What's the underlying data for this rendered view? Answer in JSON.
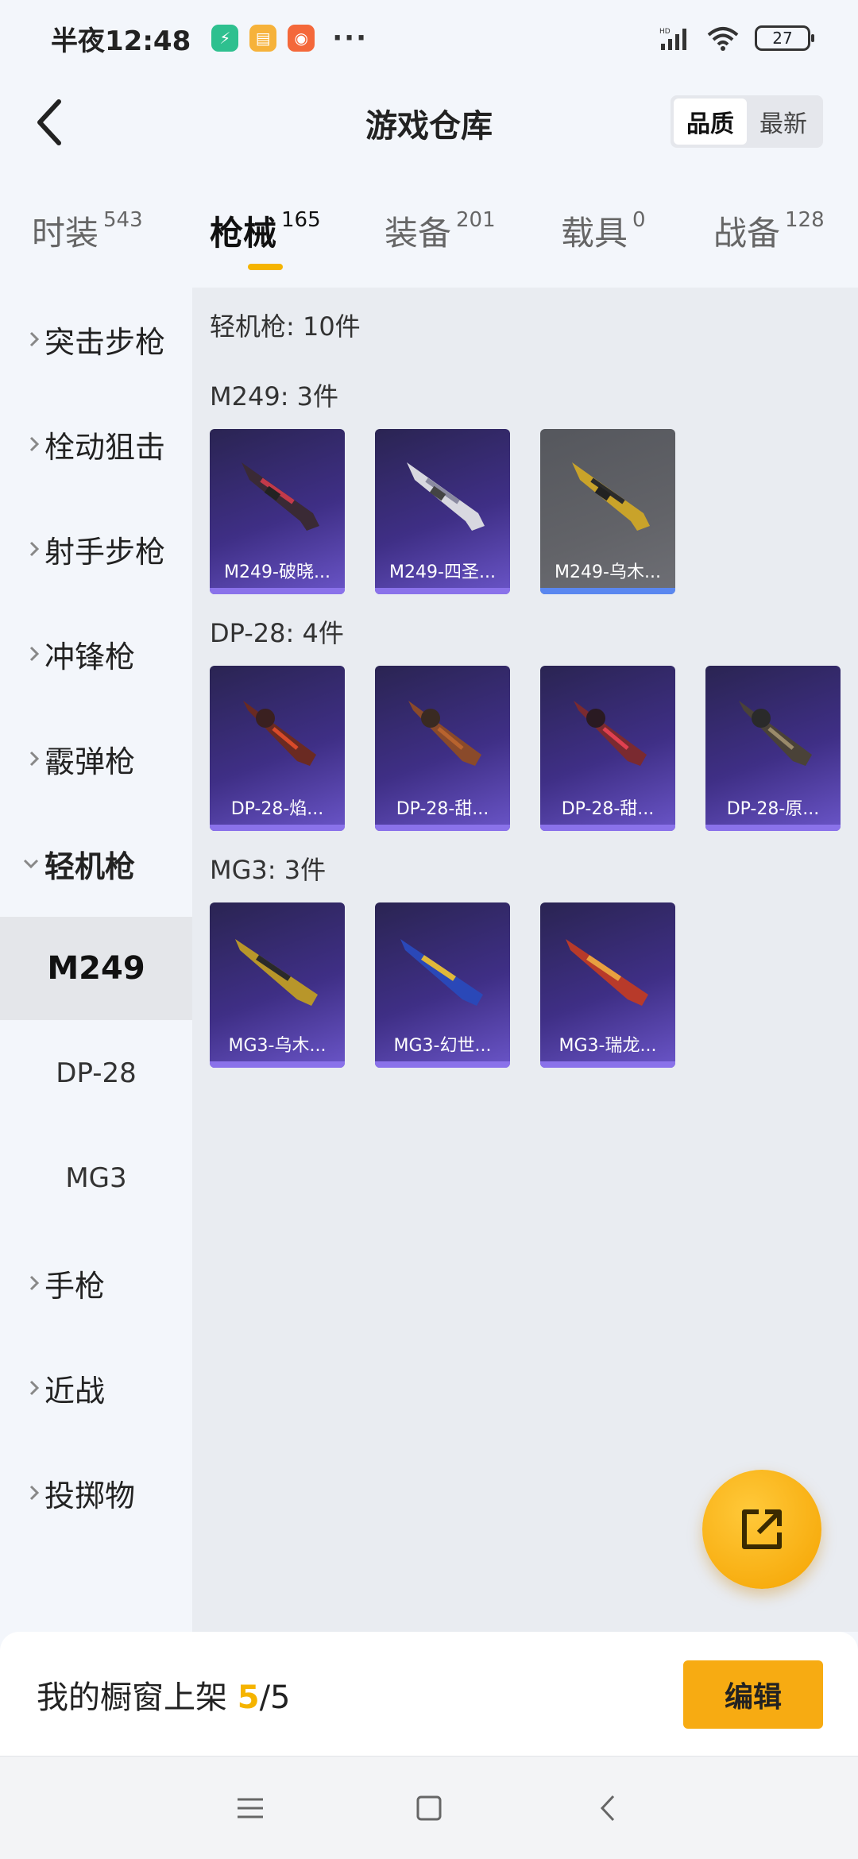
{
  "status_bar": {
    "time": "半夜12:48",
    "battery": "27",
    "more": "···"
  },
  "header": {
    "title": "游戏仓库",
    "sort_options": [
      "品质",
      "最新"
    ]
  },
  "category_tabs": [
    {
      "label": "时装",
      "count": "543"
    },
    {
      "label": "枪械",
      "count": "165",
      "active": true
    },
    {
      "label": "装备",
      "count": "201"
    },
    {
      "label": "载具",
      "count": "0"
    },
    {
      "label": "战备",
      "count": "128"
    }
  ],
  "sidebar": {
    "items": [
      {
        "label": "突击步枪"
      },
      {
        "label": "栓动狙击"
      },
      {
        "label": "射手步枪"
      },
      {
        "label": "冲锋枪"
      },
      {
        "label": "霰弹枪"
      },
      {
        "label": "轻机枪",
        "expanded": true
      },
      {
        "label": "手枪"
      },
      {
        "label": "近战"
      },
      {
        "label": "投掷物"
      }
    ],
    "sub_items": [
      {
        "label": "M249",
        "selected": true
      },
      {
        "label": "DP-28"
      },
      {
        "label": "MG3"
      }
    ]
  },
  "content": {
    "summary": "轻机枪: 10件",
    "groups": [
      {
        "title": "M249: 3件",
        "items": [
          {
            "name": "M249-破晓...",
            "rarity": "purple"
          },
          {
            "name": "M249-四圣...",
            "rarity": "purple"
          },
          {
            "name": "M249-乌木...",
            "rarity": "gray"
          }
        ]
      },
      {
        "title": "DP-28: 4件",
        "items": [
          {
            "name": "DP-28-焰...",
            "rarity": "purple"
          },
          {
            "name": "DP-28-甜...",
            "rarity": "purple"
          },
          {
            "name": "DP-28-甜...",
            "rarity": "purple"
          },
          {
            "name": "DP-28-原...",
            "rarity": "purple"
          }
        ]
      },
      {
        "title": "MG3: 3件",
        "items": [
          {
            "name": "MG3-乌木...",
            "rarity": "purple"
          },
          {
            "name": "MG3-幻世...",
            "rarity": "purple"
          },
          {
            "name": "MG3-瑞龙...",
            "rarity": "purple"
          }
        ]
      }
    ]
  },
  "bottom": {
    "shelf_label": "我的橱窗上架",
    "shelf_current": "5",
    "shelf_total": "/5",
    "edit_label": "编辑"
  },
  "colors": {
    "accent": "#f5b400",
    "edit_button": "#f7ab12",
    "card_purple": "#3f2f86",
    "card_gray": "#626368"
  },
  "icons": {
    "back": "back-icon",
    "fab": "share-external-icon",
    "nav": [
      "menu-icon",
      "home-icon",
      "back-nav-icon"
    ]
  }
}
